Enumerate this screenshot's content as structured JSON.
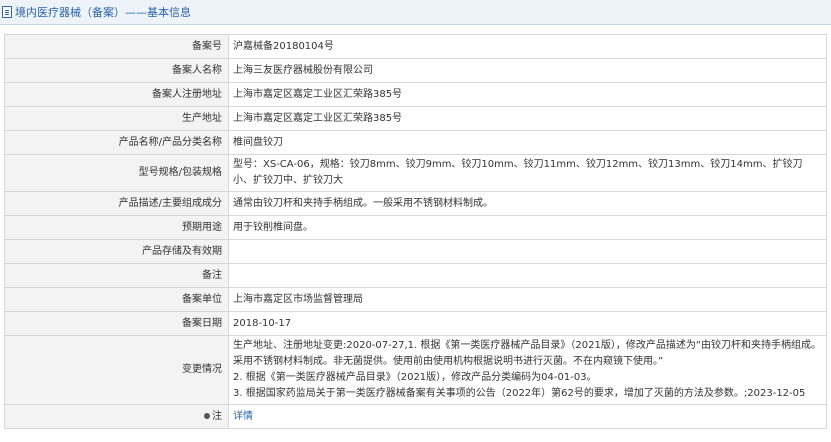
{
  "header": {
    "title": "境内医疗器械（备案）——基本信息"
  },
  "rows": [
    {
      "label": "备案号",
      "value": "沪嘉械备20180104号"
    },
    {
      "label": "备案人名称",
      "value": "上海三友医疗器械股份有限公司"
    },
    {
      "label": "备案人注册地址",
      "value": "上海市嘉定区嘉定工业区汇荣路385号"
    },
    {
      "label": "生产地址",
      "value": "上海市嘉定区嘉定工业区汇荣路385号"
    },
    {
      "label": "产品名称/产品分类名称",
      "value": "椎间盘铰刀"
    },
    {
      "label": "型号规格/包装规格",
      "value": "型号：XS-CA-06，规格：铰刀8mm、铰刀9mm、铰刀10mm、铰刀11mm、铰刀12mm、铰刀13mm、铰刀14mm、扩铰刀小、扩铰刀中、扩铰刀大"
    },
    {
      "label": "产品描述/主要组成成分",
      "value": "通常由铰刀杆和夹持手柄组成。一般采用不锈钢材料制成。"
    },
    {
      "label": "预期用途",
      "value": "用于铰削椎间盘。"
    },
    {
      "label": "产品存储及有效期",
      "value": ""
    },
    {
      "label": "备注",
      "value": ""
    },
    {
      "label": "备案单位",
      "value": "上海市嘉定区市场监督管理局"
    },
    {
      "label": "备案日期",
      "value": "2018-10-17"
    }
  ],
  "changes": {
    "label": "变更情况",
    "lines": [
      "生产地址、注册地址变更:2020-07-27,1. 根据《第一类医疗器械产品目录》（2021版），修改产品描述为“由铰刀杆和夹持手柄组成。采用不锈钢材料制成。非无菌提供。使用前由使用机构根据说明书进行灭菌。不在内窥镜下使用。”",
      "2. 根据《第一类医疗器械产品目录》（2021版），修改产品分类编码为04-01-03。",
      "3. 根据国家药监局关于第一类医疗器械备案有关事项的公告（2022年）第62号的要求，增加了灭菌的方法及参数。;2023-12-05"
    ]
  },
  "note": {
    "label": "注",
    "link_text": "详情"
  }
}
